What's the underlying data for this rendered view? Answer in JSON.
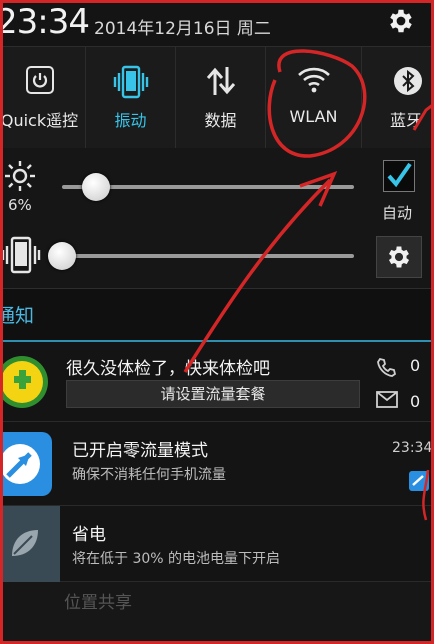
{
  "status": {
    "time": "23:34",
    "date": "2014年12月16日 周二"
  },
  "toggles": [
    {
      "label": "Quick遥控",
      "icon": "power-remote-icon",
      "active": false
    },
    {
      "label": "振动",
      "icon": "vibrate-icon",
      "active": true
    },
    {
      "label": "数据",
      "icon": "data-arrows-icon",
      "active": false
    },
    {
      "label": "WLAN",
      "icon": "wifi-icon",
      "active": false
    },
    {
      "label": "蓝牙",
      "icon": "bluetooth-icon",
      "active": false
    }
  ],
  "brightness": {
    "percent_label": "6%",
    "level": 0.06,
    "auto_label": "自动",
    "auto_checked": true
  },
  "volume": {
    "level": 0.0
  },
  "notifications_header": "通知",
  "notifications": [
    {
      "title": "很久没体检了，快来体检吧",
      "button": "请设置流量套餐",
      "call_count": "0",
      "msg_count": "0"
    },
    {
      "title": "已开启零流量模式",
      "subtitle": "确保不消耗任何手机流量",
      "time": "23:34"
    },
    {
      "title": "省电",
      "subtitle": "将在低于 30% 的电池电量下开启"
    }
  ],
  "background_row": "位置共享",
  "colors": {
    "accent": "#37c4e8",
    "annotation": "#d42626"
  }
}
